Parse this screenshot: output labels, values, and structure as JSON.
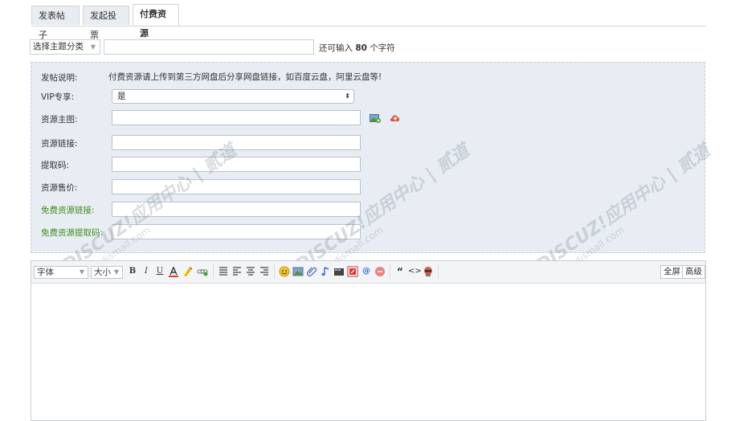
{
  "tabs": [
    {
      "label": "发表帖子",
      "active": false
    },
    {
      "label": "发起投票",
      "active": false
    },
    {
      "label": "付费资源",
      "active": true
    }
  ],
  "subject": {
    "category_value": "选择主题分类",
    "remaining_prefix": "还可输入",
    "remaining_count": "80",
    "remaining_suffix": "个字符"
  },
  "form": {
    "desc_label": "发帖说明:",
    "desc_text": "付费资源请上传到第三方网盘后分享网盘链接，如百度云盘，阿里云盘等!",
    "vip_label": "VIP专享:",
    "vip_value": "是",
    "image_label": "资源主图:",
    "link_label": "资源链接:",
    "code_label": "提取码:",
    "price_label": "资源售价:",
    "free_link_label": "免费资源链接:",
    "free_code_label": "免费资源提取码:"
  },
  "watermark": {
    "brand": "DISCUZ!应用中心 | 贰道",
    "domain": "addon.dismall.com"
  },
  "editor": {
    "font_label": "字体",
    "size_label": "大小",
    "fullscreen_label": "全屏",
    "advanced_label": "高级",
    "bold_glyph": "B",
    "italic_glyph": "I",
    "underline_glyph": "U",
    "quote_glyph": "“",
    "code_glyph": "<>",
    "at_glyph": "@"
  },
  "colors": {
    "accent_green": "#3c8c1c",
    "panel_bg": "#e8edf3"
  }
}
